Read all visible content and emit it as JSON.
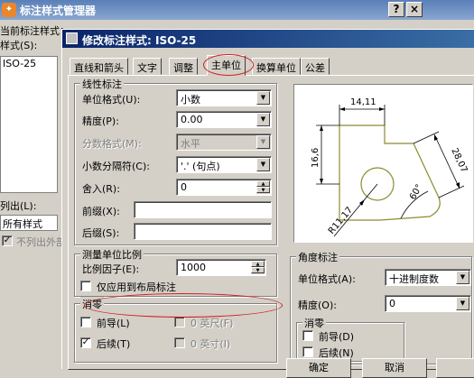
{
  "parent": {
    "title": "标注样式管理器",
    "help_btn": "?",
    "close_btn": "×",
    "current_style_label": "当前标注样式：",
    "styles_label": "样式(S):",
    "style_item": "ISO-25",
    "list_label": "列出(L):",
    "list_value": "所有样式",
    "exclude_xref_label": "不列出外部"
  },
  "dialog": {
    "title": "修改标注样式: ISO-25",
    "tabs": [
      "直线和箭头",
      "文字",
      "调整",
      "主单位",
      "换算单位",
      "公差"
    ],
    "active_tab": "主单位"
  },
  "linear": {
    "group_title": "线性标注",
    "unit_format_label": "单位格式(U):",
    "unit_format_value": "小数",
    "precision_label": "精度(P):",
    "precision_value": "0.00",
    "fraction_format_label": "分数格式(M):",
    "fraction_format_value": "水平",
    "decimal_sep_label": "小数分隔符(C):",
    "decimal_sep_value": "'.' (句点)",
    "round_off_label": "舍入(R):",
    "round_off_value": "0",
    "prefix_label": "前缀(X):",
    "suffix_label": "后缀(S):"
  },
  "scale": {
    "group_title": "测量单位比例",
    "factor_label": "比例因子(E):",
    "factor_value": "1000",
    "layout_only_label": "仅应用到布局标注"
  },
  "zero_suppression": {
    "group_title": "消零",
    "leading_label": "前导(L)",
    "trailing_label": "后续(T)",
    "feet_label": "0 英尺(F)",
    "inches_label": "0 英寸(I)"
  },
  "preview": {
    "dim_top": "14,11",
    "dim_left": "16,6",
    "dim_right": "28,07",
    "dim_angle": "60°",
    "dim_radius": "R11,17"
  },
  "angular": {
    "group_title": "角度标注",
    "unit_format_label": "单位格式(A):",
    "unit_format_value": "十进制度数",
    "precision_label": "精度(O):",
    "precision_value": "0",
    "zero_group_title": "消零",
    "leading_label": "前导(D)",
    "trailing_label": "后续(N)"
  },
  "buttons": {
    "ok": "确定",
    "cancel": "取消"
  }
}
